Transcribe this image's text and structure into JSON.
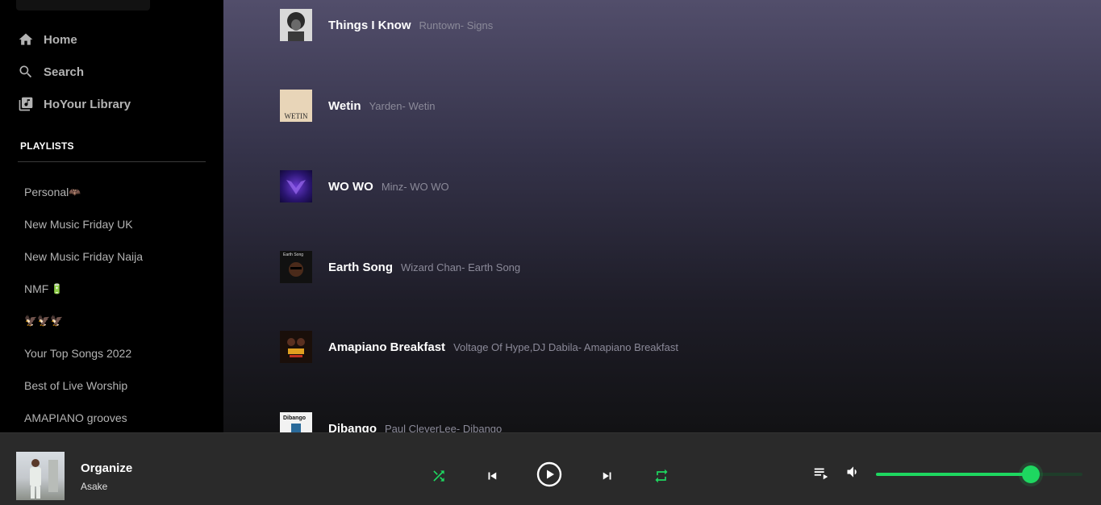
{
  "sidebar": {
    "nav": [
      {
        "label": "Home",
        "icon": "home-icon"
      },
      {
        "label": "Search",
        "icon": "search-icon"
      },
      {
        "label": "HoYour Library",
        "icon": "library-icon"
      }
    ],
    "playlists_heading": "PLAYLISTS",
    "playlists": [
      {
        "label": "Personal",
        "emoji": "🦇"
      },
      {
        "label": "New Music Friday UK"
      },
      {
        "label": "New Music Friday Naija"
      },
      {
        "label": "NMF",
        "emoji": "🔋"
      },
      {
        "label": "",
        "emoji": "🦅🦅🦅"
      },
      {
        "label": "Your Top Songs 2022"
      },
      {
        "label": "Best of Live Worship"
      },
      {
        "label": "AMAPIANO grooves"
      }
    ]
  },
  "tracks": [
    {
      "title": "Things I Know",
      "subtitle": "Runtown- Signs"
    },
    {
      "title": "Wetin",
      "subtitle": "Yarden- Wetin",
      "cover_text": "WETIN"
    },
    {
      "title": "WO WO",
      "subtitle": "Minz- WO WO"
    },
    {
      "title": "Earth Song",
      "subtitle": "Wizard Chan- Earth Song",
      "cover_text": "Earth Song"
    },
    {
      "title": "Amapiano Breakfast",
      "subtitle": "Voltage Of Hype,DJ Dabila- Amapiano Breakfast"
    },
    {
      "title": "Dibango",
      "subtitle": "Paul CleverLee- Dibango",
      "cover_text": "Dibango"
    }
  ],
  "now_playing": {
    "title": "Organize",
    "artist": "Asake"
  },
  "controls": {
    "shuffle_icon": "shuffle-icon",
    "previous_icon": "previous-icon",
    "play_icon": "play-icon",
    "next_icon": "next-icon",
    "repeat_icon": "repeat-icon",
    "queue_icon": "queue-icon",
    "volume_icon": "volume-icon",
    "volume_level": 0.75
  },
  "colors": {
    "accent": "#1ed760",
    "player_bg": "#2a2a2a",
    "sidebar_bg": "#000000"
  }
}
